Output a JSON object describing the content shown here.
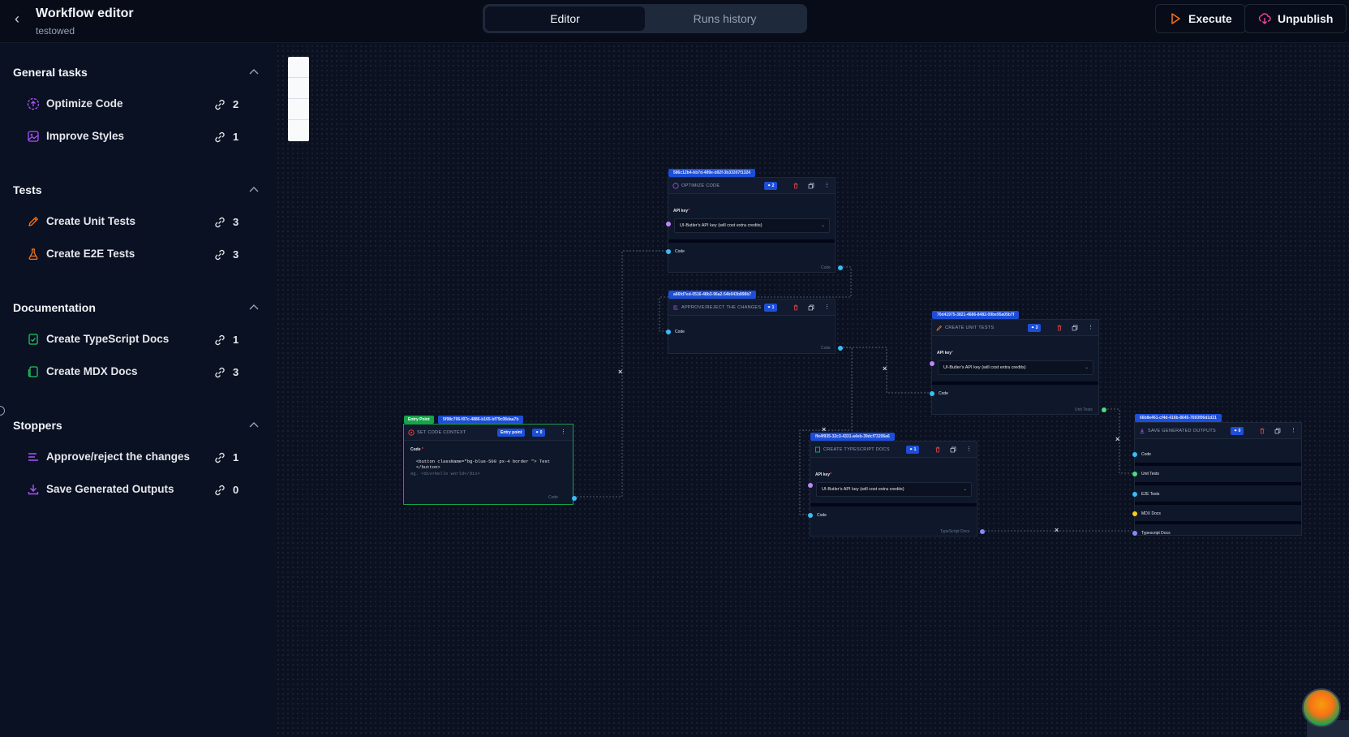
{
  "header": {
    "title": "Workflow editor",
    "subtitle": "testowed",
    "tabs": [
      "Editor",
      "Runs history"
    ],
    "execute_label": "Execute",
    "unpublish_label": "Unpublish"
  },
  "sidebar": {
    "sections": [
      {
        "title": "General tasks",
        "items": [
          {
            "label": "Optimize Code",
            "count": "2",
            "icon": "optimize-icon"
          },
          {
            "label": "Improve Styles",
            "count": "1",
            "icon": "image-icon"
          }
        ]
      },
      {
        "title": "Tests",
        "items": [
          {
            "label": "Create Unit Tests",
            "count": "3",
            "icon": "pencil-icon"
          },
          {
            "label": "Create E2E Tests",
            "count": "3",
            "icon": "flask-icon"
          }
        ]
      },
      {
        "title": "Documentation",
        "items": [
          {
            "label": "Create TypeScript Docs",
            "count": "1",
            "icon": "doc-check-icon"
          },
          {
            "label": "Create MDX Docs",
            "count": "3",
            "icon": "doc-icon"
          }
        ]
      },
      {
        "title": "Stoppers",
        "items": [
          {
            "label": "Approve/reject the changes",
            "count": "1",
            "icon": "list-icon"
          },
          {
            "label": "Save Generated Outputs",
            "count": "0",
            "icon": "download-icon"
          }
        ]
      }
    ]
  },
  "nodes": {
    "entry": {
      "entry_label": "Entry Point",
      "id": "5f98c706-f07c-4886-b165-bf79c08daa7b",
      "title": "SET CODE CONTEXT",
      "entry_badge": "Entry point",
      "count": "0",
      "code_label": "Code",
      "code_value": "<button className=\"bg-blue-500 px-4 border \"> Test </button>",
      "code_placeholder": "eg. <div>hello world</div>",
      "output_label": "Code"
    },
    "optimize": {
      "id": "586c12b4-bb7d-489e-b92f-3b33307f1324",
      "title": "OPTIMIZE CODE",
      "count": "2",
      "api_key_label": "API key",
      "api_key_value": "UI-Butler's API key (will cost extra credits)",
      "input_label": "Code",
      "output_label": "Code"
    },
    "approve": {
      "id": "a66fd7ed-0516-48b3-96a2-54b043b898b7",
      "title": "APPROVE/REJECT THE CHANGES",
      "count": "1",
      "input_label": "Code",
      "output_label": "Code"
    },
    "unit_tests": {
      "id": "70d41975-3821-4686-8482-09be95a05b7f",
      "title": "CREATE UNIT TESTS",
      "count": "3",
      "api_key_label": "API key",
      "api_key_value": "UI-Butler's API key (will cost extra credits)",
      "input_label": "Code",
      "output_label": "Unit Tests"
    },
    "ts_docs": {
      "id": "ffe4f935-32c3-4331-a4eb-39dcf73206a6",
      "title": "CREATE TYPESCRIPT DOCS",
      "count": "1",
      "api_key_label": "API key",
      "api_key_value": "UI-Butler's API key (will cost extra credits)",
      "input_label": "Code",
      "output_label": "TypeScript Docs"
    },
    "save": {
      "id": "66b8e461-cf4d-416b-8645-7693f06d1d21",
      "title": "SAVE GENERATED OUTPUTS",
      "count": "0",
      "inputs": [
        "Code",
        "Unit Tests",
        "E2E Tests",
        "MDX Docs",
        "Typescript Docs"
      ]
    }
  },
  "colors": {
    "accent_blue": "#1d4ed8",
    "entry_green": "#16a34a",
    "port_blue": "#38bdf8",
    "port_purple": "#c084fc",
    "port_green": "#4ade80",
    "port_yellow": "#facc15",
    "port_indigo": "#818cf8",
    "danger": "#ef4444"
  }
}
